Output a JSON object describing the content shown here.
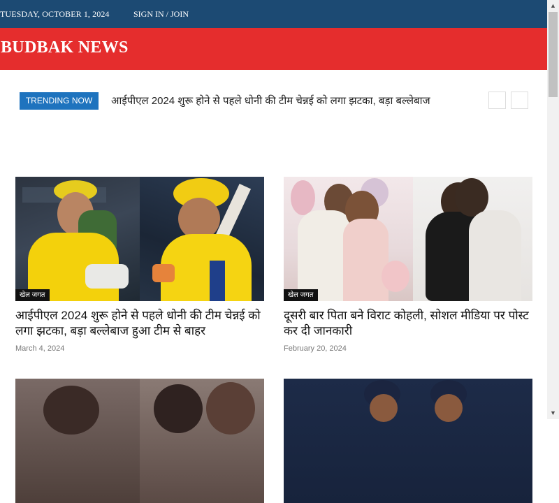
{
  "topbar": {
    "date": "TUESDAY, OCTOBER 1, 2024",
    "signin": "SIGN IN / JOIN"
  },
  "brand": {
    "name": "BUDBAK NEWS",
    "color": "#e52d2d",
    "topbar_color": "#1c4a73"
  },
  "trending": {
    "label": "TRENDING NOW",
    "headline": "आईपीएल 2024 शुरू होने से पहले धोनी की टीम चेन्नई को लगा झटका, बड़ा बल्लेबाज",
    "prev_icon": "chevron-left-icon",
    "next_icon": "chevron-right-icon"
  },
  "articles": [
    {
      "category": "खेल जगत",
      "title": "आईपीएल 2024 शुरू होने से पहले धोनी की टीम चेन्नई को लगा झटका, बड़ा बल्लेबाज हुआ टीम से बाहर",
      "date": "March 4, 2024"
    },
    {
      "category": "खेल जगत",
      "title": "दूसरी बार पिता बने विराट कोहली, सोशल मीडिया पर पोस्ट कर दी जानकारी",
      "date": "February 20, 2024"
    }
  ]
}
